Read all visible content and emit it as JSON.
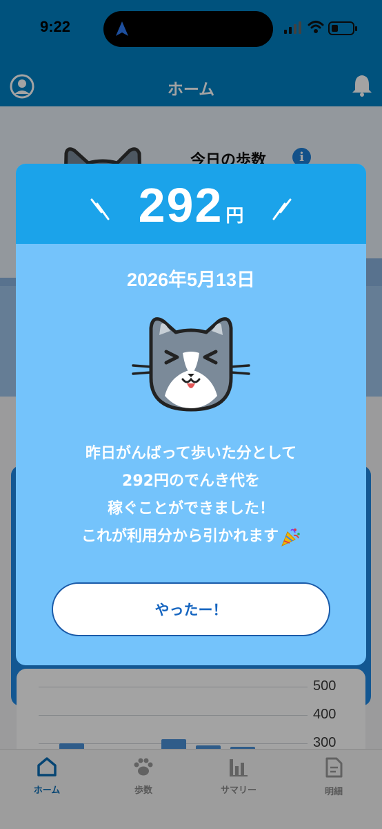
{
  "status_bar": {
    "time": "9:22"
  },
  "header": {
    "title": "ホーム"
  },
  "today_steps": {
    "title": "今日の歩数"
  },
  "chart": {
    "ticks": [
      "500",
      "400",
      "300"
    ]
  },
  "tabs": [
    {
      "label": "ホーム",
      "icon": "home-icon",
      "active": true
    },
    {
      "label": "歩数",
      "icon": "paw-icon",
      "active": false
    },
    {
      "label": "サマリー",
      "icon": "bar-chart-icon",
      "active": false
    },
    {
      "label": "明細",
      "icon": "document-icon",
      "active": false
    }
  ],
  "modal": {
    "amount": "292",
    "unit": "円",
    "date": "2026年5月13日",
    "message_lines": [
      "昨日がんばって歩いた分として",
      "292円のでんき代を",
      "稼ぐことができました！",
      "これが利用分から引かれます"
    ],
    "button_label": "やったー！"
  },
  "colors": {
    "header_blue": "#0080c4",
    "modal_head": "#1ba3ea",
    "modal_body": "#74c3fb",
    "button_text": "#1565c0"
  }
}
